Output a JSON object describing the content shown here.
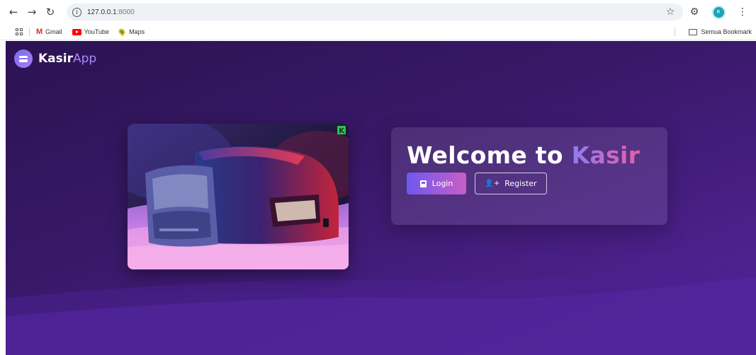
{
  "browser": {
    "url_host": "127.0.0.1",
    "url_port": ":8000",
    "profile_initial": "R",
    "bookmarks": [
      {
        "label": "Gmail",
        "icon": "gmail-icon"
      },
      {
        "label": "YouTube",
        "icon": "youtube-icon"
      },
      {
        "label": "Maps",
        "icon": "maps-icon"
      }
    ],
    "all_bookmarks_label": "Semua Bookmark"
  },
  "app": {
    "brand_part1": "Kasir",
    "brand_part2": "App",
    "welcome_part1": "Welcome to ",
    "welcome_part2": "Kasir",
    "login_label": "Login",
    "register_label": "Register",
    "image_badge": "K"
  },
  "colors": {
    "background_dark": "#2b1352",
    "background_light": "#5728a0",
    "accent_purple": "#6f58f0",
    "accent_pink": "#e85ea6"
  }
}
